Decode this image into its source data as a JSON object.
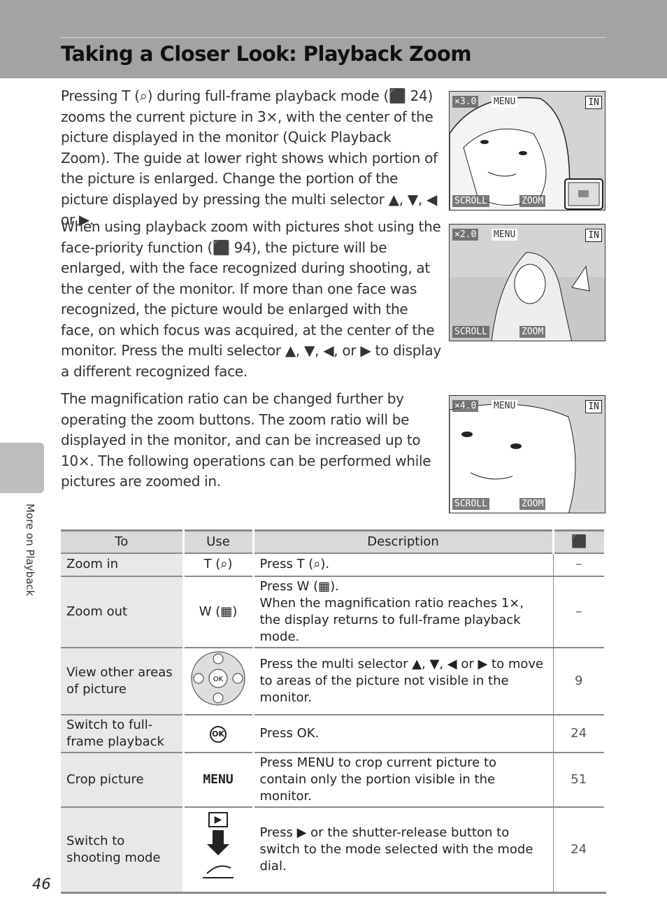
{
  "header": {
    "title": "Taking a Closer Look: Playback Zoom"
  },
  "paragraphs": [
    "Pressing T (⌕) during full-frame playback mode (⬛ 24) zooms the current picture in 3×, with the center of the picture displayed in the monitor (Quick Playback Zoom). The guide at lower right shows which portion of the picture is enlarged. Change the portion of the picture displayed by pressing the multi selector ▲, ▼, ◀ or ▶.",
    "When using playback zoom with pictures shot using the face-priority function (⬛ 94), the picture will be enlarged, with the face recognized during shooting, at the center of the monitor. If more than one face was recognized, the picture would be enlarged with the face, on which focus was acquired, at the center of the monitor. Press the multi selector ▲, ▼, ◀, or ▶ to display a different recognized face.",
    "The magnification ratio can be changed further by operating the zoom buttons. The zoom ratio will be displayed in the monitor, and can be increased up to 10×. The following operations can be performed while pictures are zoomed in."
  ],
  "screens": [
    {
      "zoom": "×3.0",
      "menu": "MENU",
      "scroll": "SCROLL",
      "zoom_label": "ZOOM",
      "memory": "IN"
    },
    {
      "zoom": "×2.0",
      "menu": "MENU",
      "scroll": "SCROLL",
      "zoom_label": "ZOOM",
      "memory": "IN"
    },
    {
      "zoom": "×4.0",
      "menu": "MENU",
      "scroll": "SCROLL",
      "zoom_label": "ZOOM",
      "memory": "IN"
    }
  ],
  "sidebar": {
    "section": "More on Playback"
  },
  "table": {
    "headers": [
      "To",
      "Use",
      "Description",
      "⬛"
    ],
    "rows": [
      {
        "to": "Zoom in",
        "use": "T (⌕)",
        "desc": "Press T (⌕).",
        "ref": "–"
      },
      {
        "to": "Zoom out",
        "use": "W (▦)",
        "desc": "Press W (▦).",
        "desc2": "When the magnification ratio reaches 1×, the display returns to full-frame playback mode.",
        "ref": "–"
      },
      {
        "to": "View other areas of picture",
        "use": "multi selector",
        "desc": "Press the multi selector ▲, ▼, ◀ or ▶ to move to areas of the picture not visible in the monitor.",
        "ref": "9"
      },
      {
        "to": "Switch to full-frame playback",
        "use": "OK",
        "desc": "Press OK.",
        "ref": "24"
      },
      {
        "to": "Crop picture",
        "use": "MENU",
        "desc": "Press MENU to crop current picture to contain only the portion visible in the monitor.",
        "ref": "51"
      },
      {
        "to": "Switch to shooting mode",
        "use": "▶",
        "desc": "Press ▶ or the shutter-release button to switch to the mode selected with the mode dial.",
        "ref": "24"
      }
    ]
  },
  "page_number": "46"
}
